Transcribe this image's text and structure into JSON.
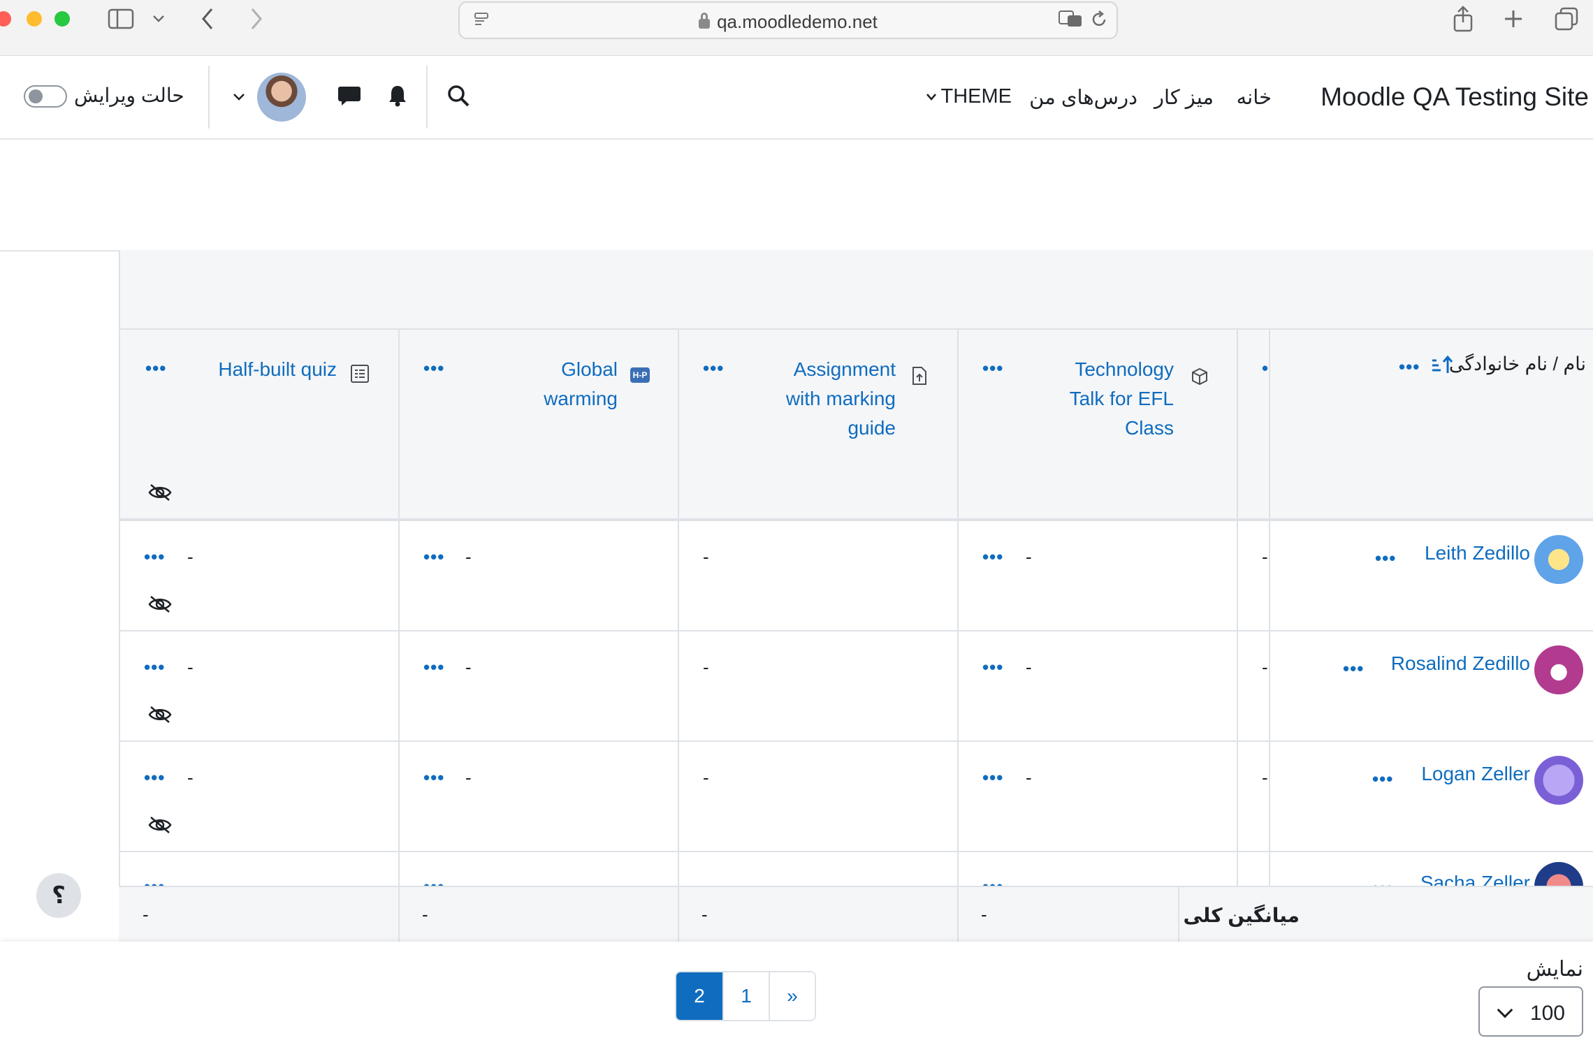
{
  "browser": {
    "url": "qa.moodledemo.net"
  },
  "navbar": {
    "site_name": "Moodle QA Testing Site",
    "links": [
      "خانه",
      "میز کار",
      "درس‌های من",
      "THEME"
    ],
    "edit_mode_label": "حالت ویرایش"
  },
  "grid": {
    "name_header": "نام / نام خانوادگی",
    "columns": [
      {
        "title_lines": [
          "Technology",
          "Talk for EFL",
          "Class"
        ],
        "icon": "package-icon"
      },
      {
        "title_lines": [
          "Assignment",
          "with marking",
          "guide"
        ],
        "icon": "assignment-icon"
      },
      {
        "title_lines": [
          "Global",
          "warming"
        ],
        "icon": "h5p-icon",
        "icon_text": "H-P"
      },
      {
        "title_lines": [
          "Half-built quiz"
        ],
        "icon": "quiz-icon",
        "hidden": true
      }
    ],
    "rows": [
      {
        "name": "Leith Zedillo",
        "values": [
          "-",
          "-",
          "-",
          "-",
          "-"
        ]
      },
      {
        "name": "Rosalind Zedillo",
        "values": [
          "-",
          "-",
          "-",
          "-",
          "-"
        ]
      },
      {
        "name": "Logan Zeller",
        "values": [
          "-",
          "-",
          "-",
          "-",
          "-"
        ]
      },
      {
        "name": "Sacha Zeller",
        "values": [
          "-",
          "-",
          "-",
          "-",
          "-"
        ]
      }
    ],
    "overall_average_label": "میانگین کلی",
    "overall_average_values": [
      "-",
      "-",
      "-",
      "-"
    ]
  },
  "pagination": {
    "pages": [
      "»",
      "1",
      "2"
    ],
    "current": "2"
  },
  "per_page": {
    "label": "نمایش",
    "value": "100"
  },
  "help": {
    "label": "؟"
  },
  "colors": {
    "link": "#0f6cbf",
    "header_bg": "#f5f6f8",
    "border": "#dee2e6"
  }
}
